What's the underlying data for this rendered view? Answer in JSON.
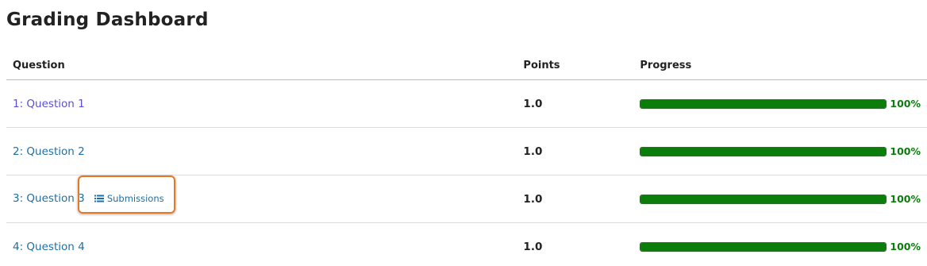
{
  "page": {
    "title": "Grading Dashboard"
  },
  "table": {
    "headers": {
      "question": "Question",
      "points": "Points",
      "progress": "Progress"
    },
    "rows": [
      {
        "question": "1: Question 1",
        "points": "1.0",
        "progress_label": "100%",
        "progress_fraction": 1.0,
        "visited": true
      },
      {
        "question": "2: Question 2",
        "points": "1.0",
        "progress_label": "100%",
        "progress_fraction": 1.0,
        "visited": false
      },
      {
        "question": "3: Question 3",
        "points": "1.0",
        "progress_label": "100%",
        "progress_fraction": 1.0,
        "visited": false,
        "submissions_label": "Submissions",
        "submissions_icon": "list-icon",
        "highlighted": true
      },
      {
        "question": "4: Question 4",
        "points": "1.0",
        "progress_label": "100%",
        "progress_fraction": 1.0,
        "visited": false
      }
    ]
  },
  "colors": {
    "link": "#1f6ea3",
    "visited_link": "#5a4fd6",
    "progress": "#0a7d0a",
    "highlight": "#e87722"
  }
}
